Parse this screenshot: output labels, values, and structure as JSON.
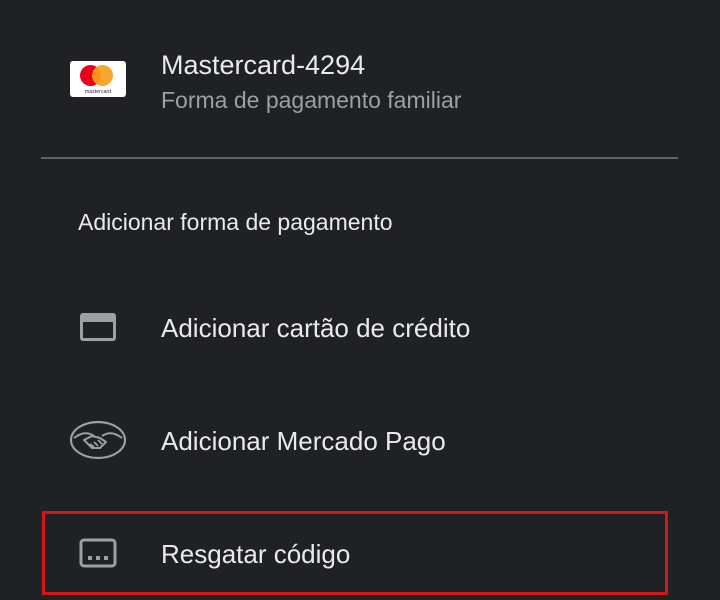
{
  "saved_method": {
    "title": "Mastercard-4294",
    "subtitle": "Forma de pagamento familiar",
    "logo_text": "mastercard",
    "logo_icon": "mastercard-logo-icon"
  },
  "section_header": "Adicionar forma de pagamento",
  "options": [
    {
      "label": "Adicionar cartão de crédito",
      "icon": "credit-card-icon"
    },
    {
      "label": "Adicionar Mercado Pago",
      "icon": "handshake-icon"
    },
    {
      "label": "Resgatar código",
      "icon": "redeem-code-icon"
    }
  ],
  "colors": {
    "background": "#202124",
    "text_primary": "#e8eaed",
    "text_secondary": "#9aa0a6",
    "icon": "#9aa0a6",
    "highlight": "#d2171c"
  }
}
